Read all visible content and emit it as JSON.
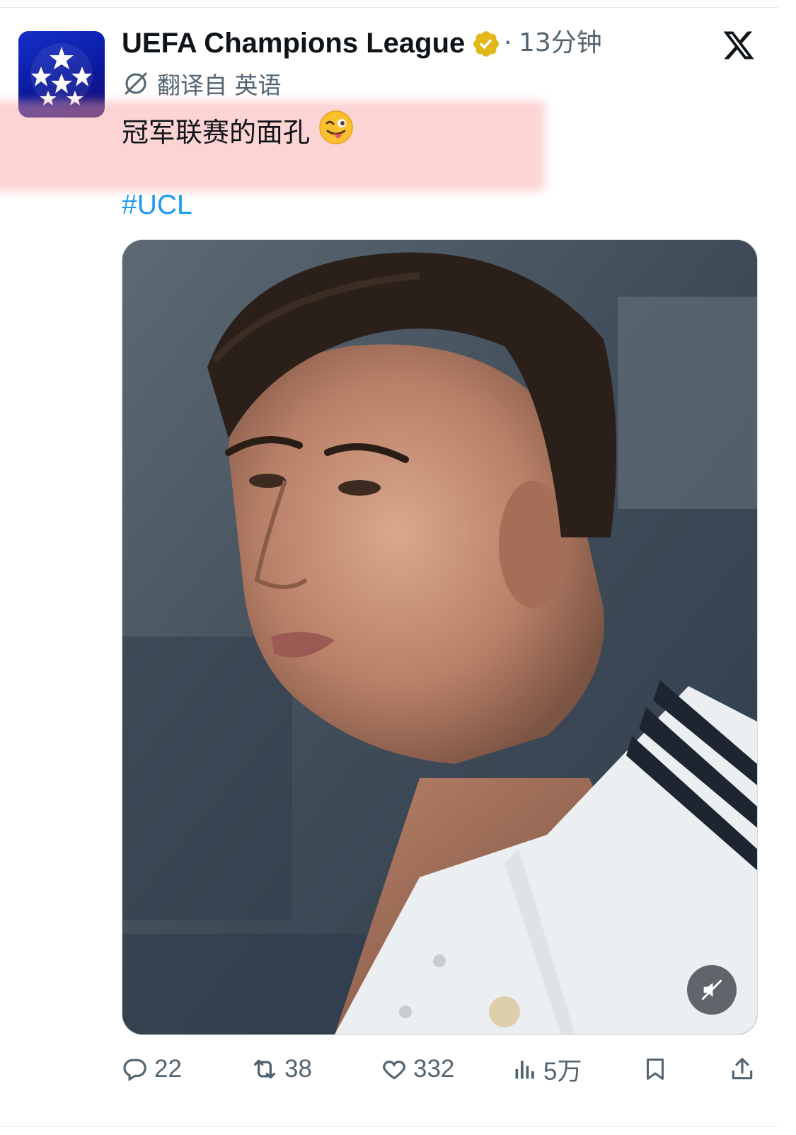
{
  "account": {
    "name": "UEFA Champions League",
    "separator": "·",
    "time": "13分钟"
  },
  "translation": {
    "label": "翻译自 英语"
  },
  "tweet": {
    "text": "冠军联赛的面孔",
    "emoji": "😜",
    "hashtag": "#UCL"
  },
  "media": {
    "type": "video",
    "muted": true
  },
  "actions": {
    "replies": "22",
    "reposts": "38",
    "likes": "332",
    "views": "5万"
  },
  "colors": {
    "text": "#0f1419",
    "secondary": "#536471",
    "link": "#1d9bf0",
    "verified": "#e2b719",
    "highlight": "#fab0b0"
  },
  "icons": [
    "verified-badge-icon",
    "x-logo-icon",
    "translate-icon",
    "mute-icon",
    "reply-icon",
    "repost-icon",
    "like-icon",
    "views-icon",
    "bookmark-icon",
    "share-icon"
  ]
}
